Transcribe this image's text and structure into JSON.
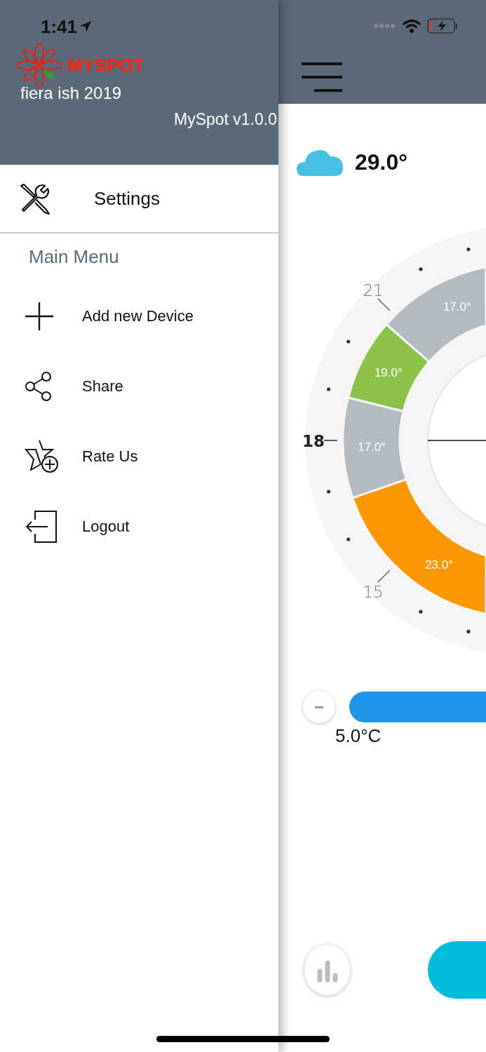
{
  "status_bar": {
    "time": "1:41"
  },
  "drawer": {
    "brand": "MYSPOT",
    "event": "fiera ish 2019",
    "version": "MySpot v1.0.0",
    "settings": {
      "label": "Settings"
    },
    "section": "Main Menu",
    "items": [
      {
        "kind": "add",
        "label": "Add new Device"
      },
      {
        "kind": "share",
        "label": "Share"
      },
      {
        "kind": "rate",
        "label": "Rate Us"
      },
      {
        "kind": "logout",
        "label": "Logout"
      }
    ]
  },
  "main": {
    "weather": {
      "temperature": "29.0°"
    },
    "dial": {
      "hour_labels": [
        {
          "label": "21",
          "kind": "minor"
        },
        {
          "label": "18",
          "kind": "major"
        },
        {
          "label": "15",
          "kind": "minor"
        }
      ],
      "segments": [
        {
          "label": "17.0°",
          "color": "#b3bac1"
        },
        {
          "label": "19.0°",
          "color": "#8bc34a"
        },
        {
          "label": "17.0°",
          "color": "#b3bac1"
        },
        {
          "label": "23.0°",
          "color": "#fb9700"
        }
      ]
    },
    "slider": {
      "min_label": "5.0°C"
    }
  }
}
